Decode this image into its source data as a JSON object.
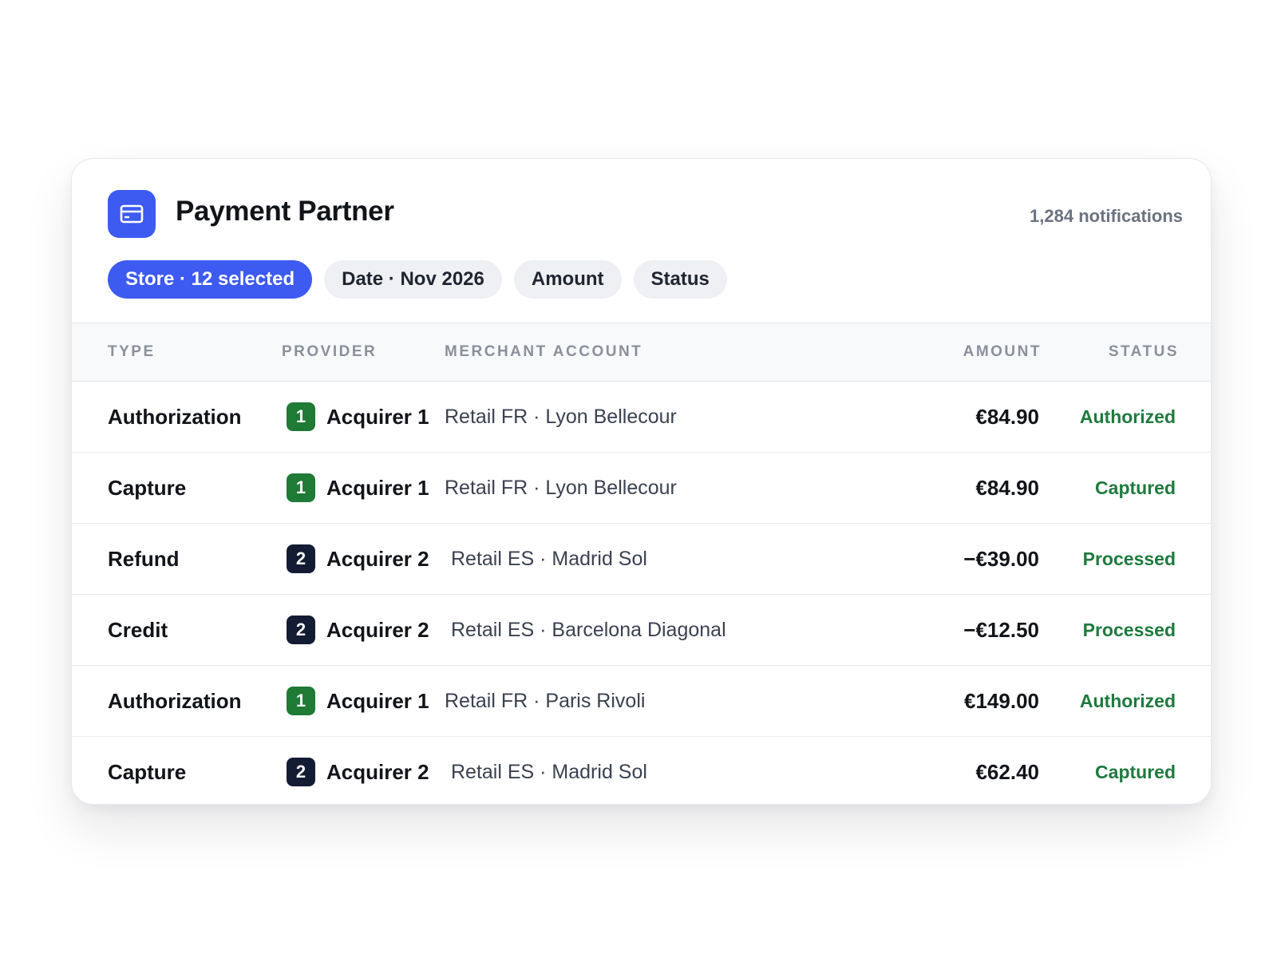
{
  "app": {
    "title": "Payment Partner",
    "icon": "credit-card-icon",
    "accent_color": "#3d5af1",
    "notifications": "1,284 notifications"
  },
  "filters": [
    {
      "label": "Store · 12 selected",
      "active": true
    },
    {
      "label": "Date · Nov 2026",
      "active": false
    },
    {
      "label": "Amount",
      "active": false
    },
    {
      "label": "Status",
      "active": false
    }
  ],
  "table": {
    "headers": {
      "type": "TYPE",
      "provider": "PROVIDER",
      "merchant": "MERCHANT ACCOUNT",
      "amount": "AMOUNT",
      "status": "STATUS"
    },
    "rows": [
      {
        "type": "Authorization",
        "badge": "1",
        "badge_color": "#1e7a34",
        "provider": "Acquirer 1",
        "merchant": "Retail FR · Lyon Bellecour",
        "amount": "€84.90",
        "status": "Authorized"
      },
      {
        "type": "Capture",
        "badge": "1",
        "badge_color": "#1e7a34",
        "provider": "Acquirer 1",
        "merchant": "Retail FR · Lyon Bellecour",
        "amount": "€84.90",
        "status": "Captured"
      },
      {
        "type": "Refund",
        "badge": "2",
        "badge_color": "#141c33",
        "provider": "Acquirer 2",
        "merchant": "Retail ES · Madrid Sol",
        "amount": "−€39.00",
        "status": "Processed"
      },
      {
        "type": "Credit",
        "badge": "2",
        "badge_color": "#141c33",
        "provider": "Acquirer 2",
        "merchant": "Retail ES · Barcelona Diagonal",
        "amount": "−€12.50",
        "status": "Processed"
      },
      {
        "type": "Authorization",
        "badge": "1",
        "badge_color": "#1e7a34",
        "provider": "Acquirer 1",
        "merchant": "Retail FR · Paris Rivoli",
        "amount": "€149.00",
        "status": "Authorized"
      },
      {
        "type": "Capture",
        "badge": "2",
        "badge_color": "#141c33",
        "provider": "Acquirer 2",
        "merchant": "Retail ES · Madrid Sol",
        "amount": "€62.40",
        "status": "Captured"
      }
    ]
  }
}
